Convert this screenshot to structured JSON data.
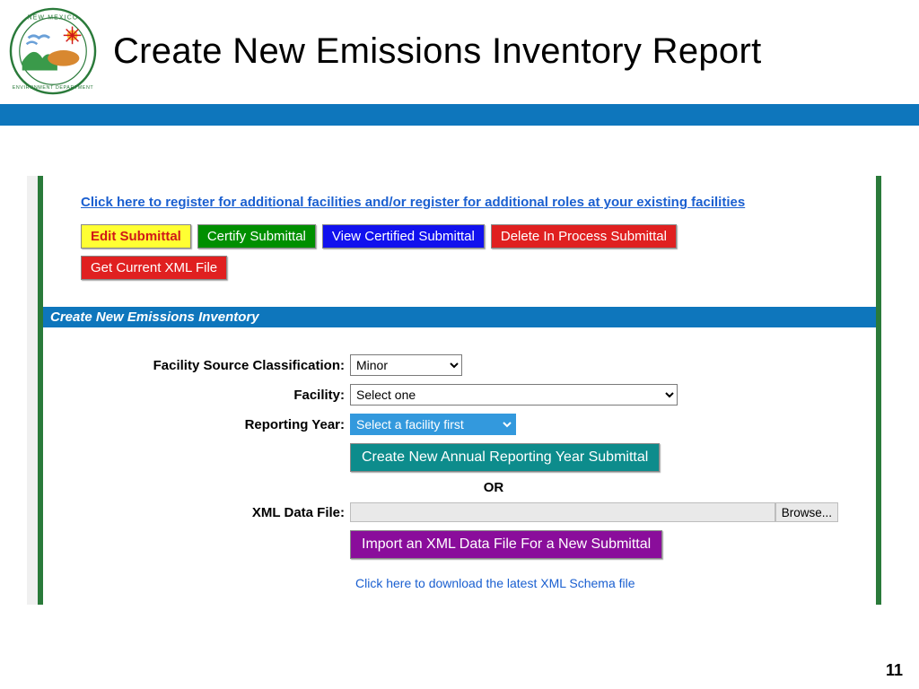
{
  "header": {
    "title": "Create New Emissions Inventory Report"
  },
  "topLink": "Click here to register for additional facilities and/or register for additional roles at your existing facilities",
  "buttons": {
    "editSubmittal": "Edit Submittal",
    "certifySubmittal": "Certify Submittal",
    "viewCertified": "View Certified Submittal",
    "deleteInProcess": "Delete In Process Submittal",
    "getXml": "Get Current XML File",
    "createNew": "Create New Annual Reporting Year Submittal",
    "importXml": "Import an XML Data File For a New Submittal",
    "browse": "Browse..."
  },
  "sectionTitle": "Create New Emissions Inventory",
  "form": {
    "facilitySourceLabel": "Facility Source Classification:",
    "facilitySourceValue": "Minor",
    "facilityLabel": "Facility:",
    "facilityValue": "Select one",
    "reportingYearLabel": "Reporting Year:",
    "reportingYearValue": "Select a facility first",
    "orText": "OR",
    "xmlDataFileLabel": "XML Data File:"
  },
  "schemaLink": "Click here to download the latest XML Schema file",
  "pageNumber": "11"
}
